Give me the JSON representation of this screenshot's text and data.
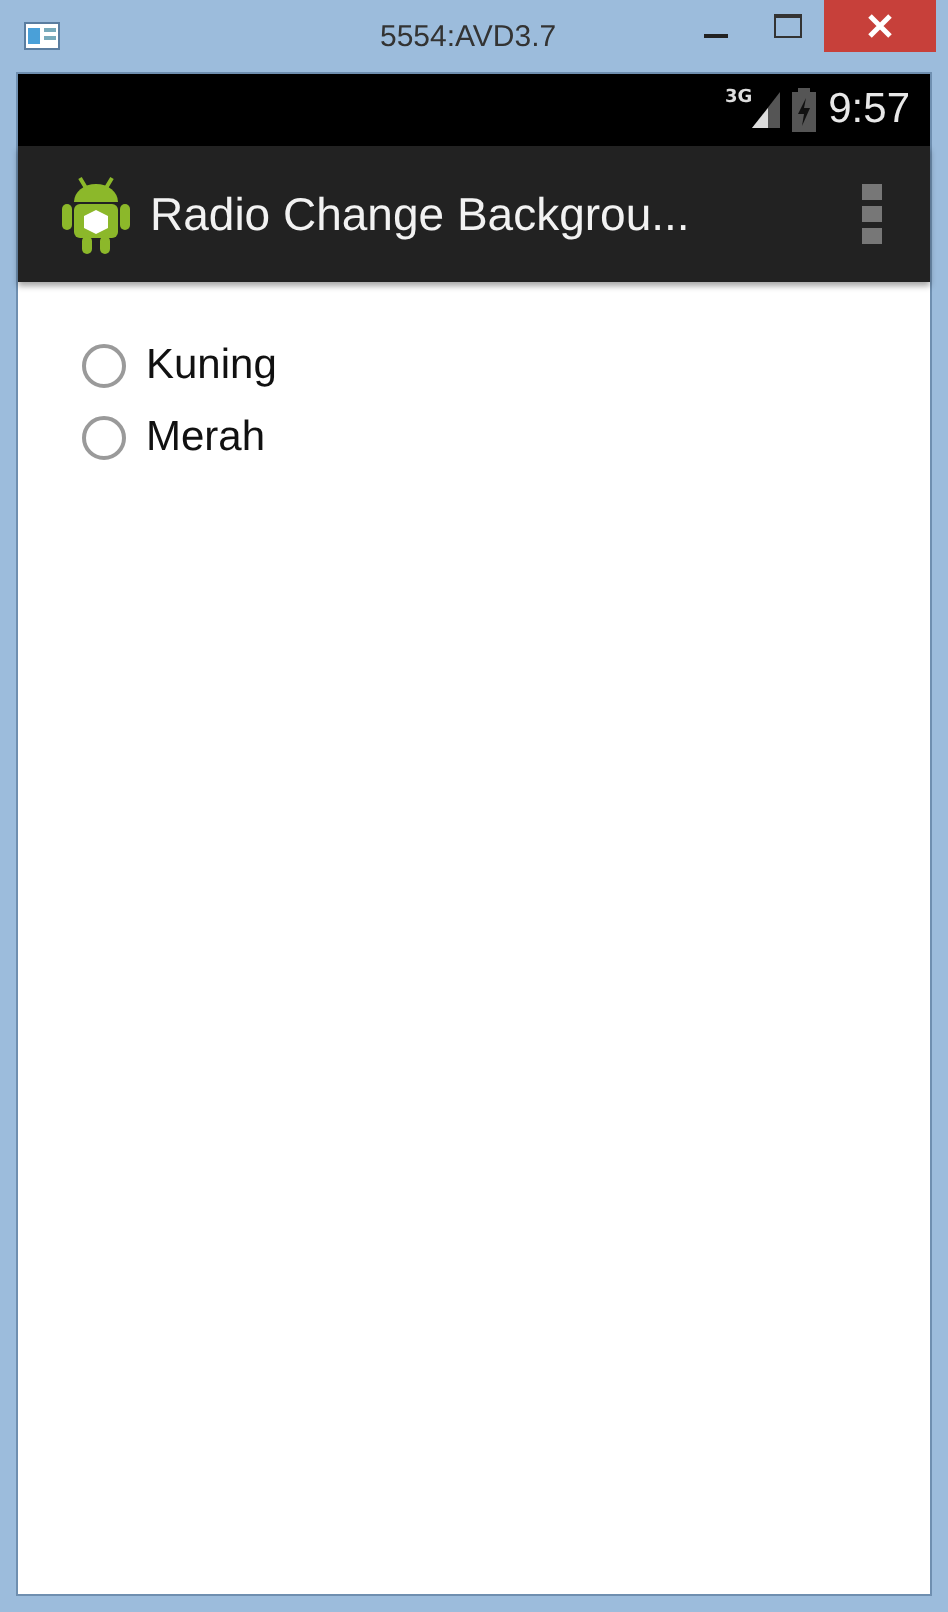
{
  "window": {
    "title": "5554:AVD3.7"
  },
  "status_bar": {
    "network": "3G",
    "time": "9:57"
  },
  "action_bar": {
    "title": "Radio Change Backgrou..."
  },
  "radios": [
    {
      "label": "Kuning",
      "selected": false
    },
    {
      "label": "Merah",
      "selected": false
    }
  ]
}
